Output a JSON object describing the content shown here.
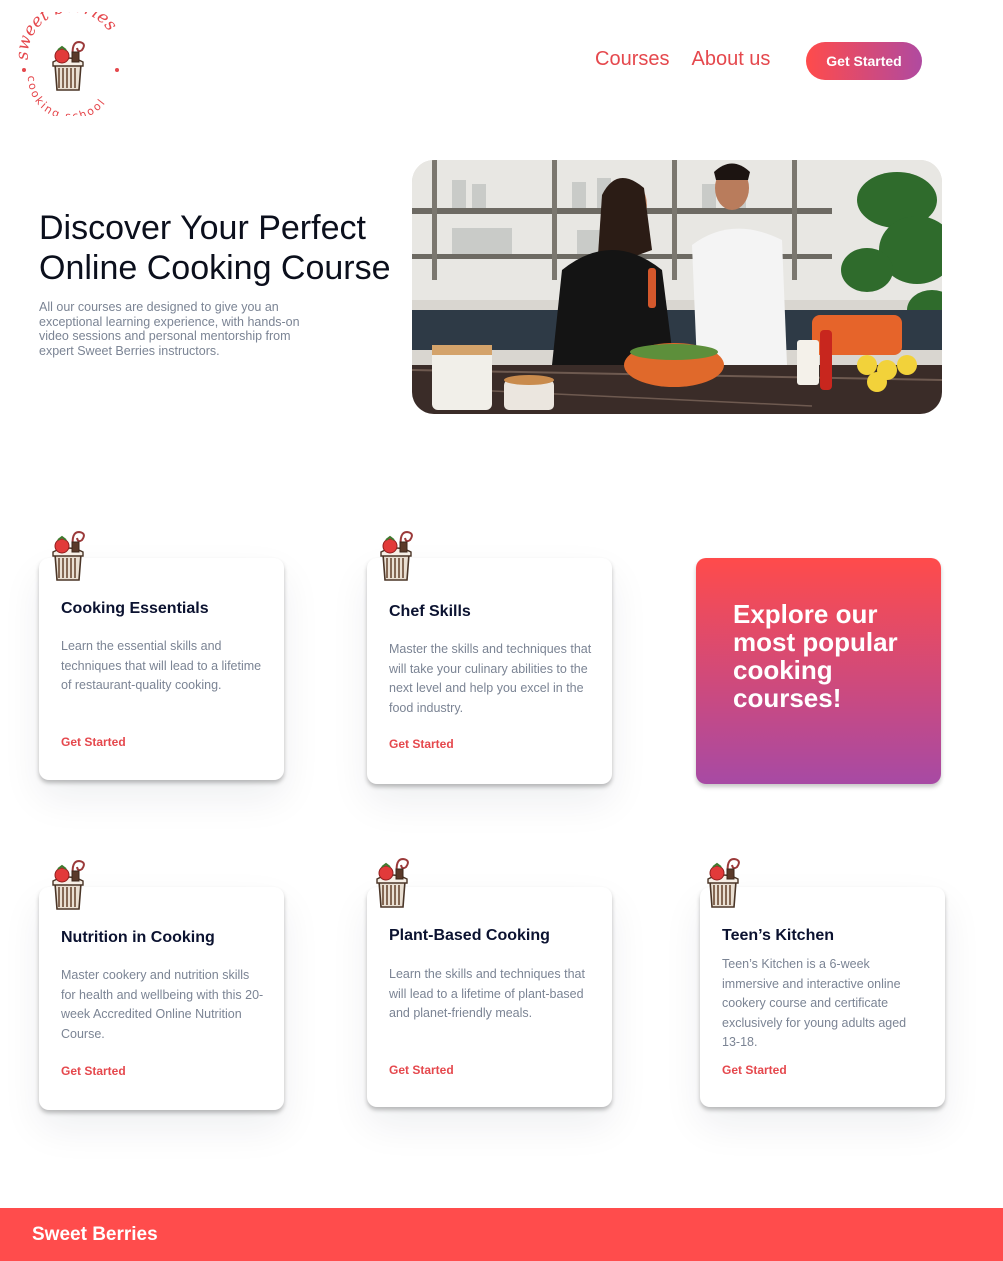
{
  "brand": {
    "logo_top": "sweet berries",
    "logo_bottom": "cooking school",
    "footer_name": "Sweet Berries"
  },
  "nav": {
    "courses": "Courses",
    "about": "About us",
    "cta": "Get Started"
  },
  "hero": {
    "title_line1": "Discover Your Perfect",
    "title_line2": "Online Cooking Course",
    "text": "All our courses are designed to give you an exceptional learning experience, with hands-on video sessions and personal mentorship from expert Sweet Berries instructors."
  },
  "promo": {
    "text": "Explore our most popular cooking courses!"
  },
  "cards": [
    {
      "title": "Cooking Essentials",
      "text": "Learn the essential skills and techniques that will lead to a lifetime of restaurant-quality cooking.",
      "cta": "Get Started"
    },
    {
      "title": "Chef Skills",
      "text": "Master the skills and techniques that will take your culinary abilities to the next level and help you excel in the food industry.",
      "cta": "Get Started"
    },
    {
      "title": "Nutrition in Cooking",
      "text": "Master cookery and nutrition skills for health and wellbeing with this 20-week Accredited Online Nutrition Course.",
      "cta": "Get Started"
    },
    {
      "title": "Plant-Based Cooking",
      "text": "Learn the skills and techniques that will lead to a lifetime of plant-based and planet-friendly meals.",
      "cta": "Get Started"
    },
    {
      "title": "Teen’s Kitchen",
      "text": "Teen’s Kitchen is a 6-week immersive and interactive online cookery course and certificate exclusively for young adults aged 13-18.",
      "cta": "Get Started"
    }
  ],
  "colors": {
    "accent": "#e5484d",
    "gradient_start": "#ff4b4b",
    "gradient_end": "#a74aa4",
    "footer": "#ff4c4c"
  }
}
